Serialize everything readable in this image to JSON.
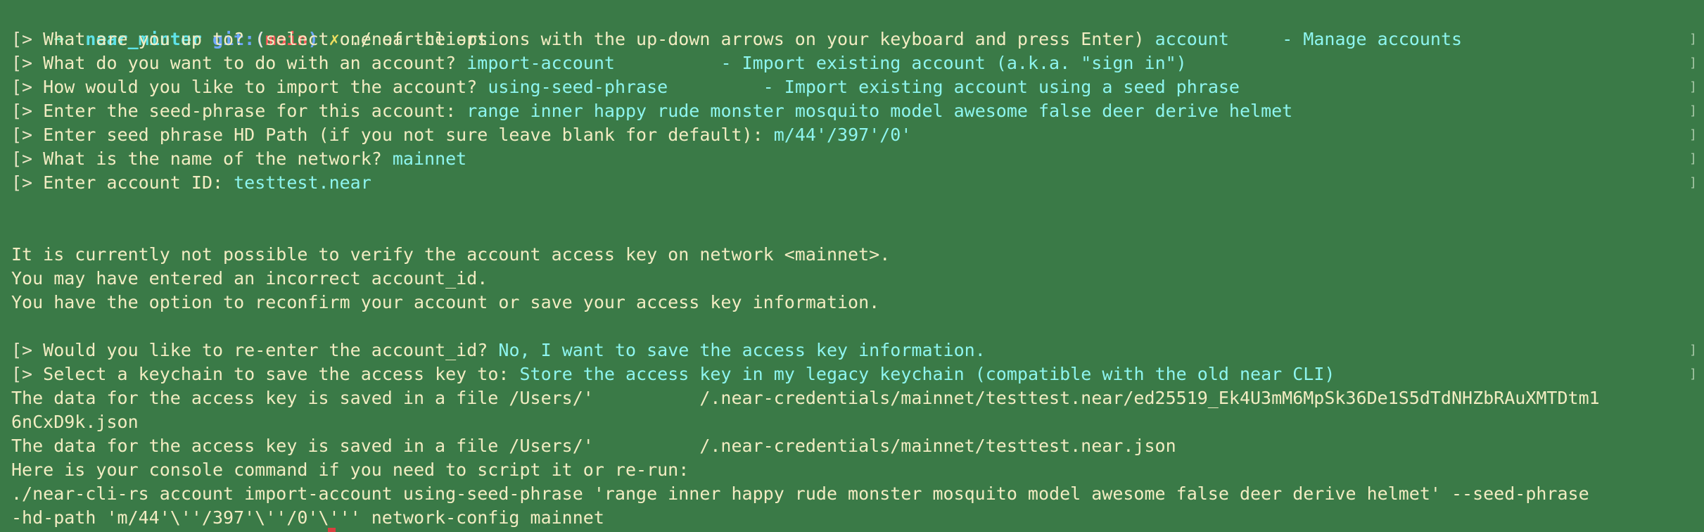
{
  "colors": {
    "background": "#3a7a47",
    "text": "#f2ecc2",
    "answer": "#8ef5ef",
    "directory": "#5fe3e8",
    "git": "#6fa8ff",
    "branch": "#ff5a5a"
  },
  "prompt": {
    "arrow": "➜",
    "directory": "near_minter",
    "git_label": "git:(",
    "branch": "main",
    "git_close": ")",
    "dirty_mark": "✗",
    "command": "./near-cli-rs"
  },
  "questions": [
    {
      "marker": "[>",
      "question": "What are you up to? (select one of the options with the up-down arrows on your keyboard and press Enter)",
      "answer": "account     - Manage accounts",
      "end_marker": "]"
    },
    {
      "marker": "[>",
      "question": "What do you want to do with an account?",
      "answer": "import-account          - Import existing account (a.k.a. \"sign in\")",
      "end_marker": "]"
    },
    {
      "marker": "[>",
      "question": "How would you like to import the account?",
      "answer": "using-seed-phrase         - Import existing account using a seed phrase",
      "end_marker": "]"
    },
    {
      "marker": "[>",
      "question": "Enter the seed-phrase for this account:",
      "answer": "range inner happy rude monster mosquito model awesome false deer derive helmet",
      "end_marker": "]"
    },
    {
      "marker": "[>",
      "question": "Enter seed phrase HD Path (if you not sure leave blank for default):",
      "answer": "m/44'/397'/0'",
      "end_marker": "]"
    },
    {
      "marker": "[>",
      "question": "What is the name of the network?",
      "answer": "mainnet",
      "end_marker": "]"
    },
    {
      "marker": "[>",
      "question": "Enter account ID:",
      "answer": "testtest.near",
      "end_marker": "]"
    }
  ],
  "warning": [
    "It is currently not possible to verify the account access key on network <mainnet>.",
    "You may have entered an incorrect account_id.",
    "You have the option to reconfirm your account or save your access key information."
  ],
  "questions2": [
    {
      "marker": "[>",
      "question": "Would you like to re-enter the account_id?",
      "answer": "No, I want to save the access key information.",
      "end_marker": "]"
    },
    {
      "marker": "[>",
      "question": "Select a keychain to save the access key to:",
      "answer": "Store the access key in my legacy keychain (compatible with the old near CLI)",
      "end_marker": "]"
    }
  ],
  "output": [
    "The data for the access key is saved in a file /Users/'          /.near-credentials/mainnet/testtest.near/ed25519_Ek4U3mM6MpSk36De1S5dTdNHZbRAuXMTDtm1",
    "6nCxD9k.json",
    "The data for the access key is saved in a file /Users/'          /.near-credentials/mainnet/testtest.near.json",
    "Here is your console command if you need to script it or re-run:",
    "./near-cli-rs account import-account using-seed-phrase 'range inner happy rude monster mosquito model awesome false deer derive helmet' --seed-phrase",
    "-hd-path 'm/44'\\''/397'\\''/0'\\''' network-config mainnet"
  ]
}
